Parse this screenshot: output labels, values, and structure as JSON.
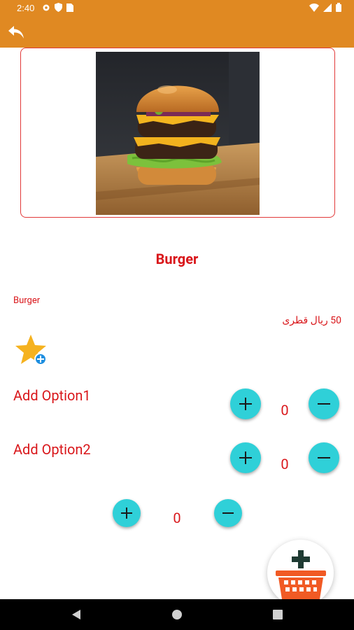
{
  "status_bar": {
    "time": "2:40",
    "icons": [
      "settings-icon",
      "shield-icon",
      "sim-card-icon",
      "wifi-icon",
      "signal-icon",
      "battery-icon"
    ]
  },
  "app_bar": {
    "back_icon": "back-arrow-icon",
    "color": "#e08922"
  },
  "product": {
    "image_alt": "burger-photo",
    "title": "Burger",
    "description": "Burger",
    "price": "50 ريال قطرى",
    "favorite_icon": "star-add-icon"
  },
  "options": [
    {
      "label": "Add Option1",
      "count": "0"
    },
    {
      "label": "Add Option2",
      "count": "0"
    }
  ],
  "quantity": {
    "count": "0"
  },
  "cart_button": {
    "icon": "add-to-basket-icon"
  },
  "colors": {
    "accent": "#e08922",
    "text_red": "#d9161a",
    "button_cyan": "#2fd0d8"
  }
}
